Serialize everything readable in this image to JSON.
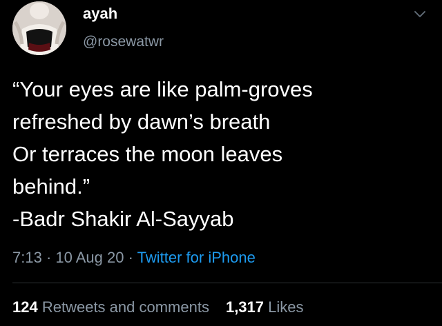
{
  "author": {
    "display_name": "ayah",
    "handle": "@rosewatwr"
  },
  "tweet": {
    "lines": [
      "“Your eyes are like palm-groves",
      "refreshed by dawn’s breath",
      "Or terraces the moon leaves",
      "behind.”",
      "-Badr Shakir Al-Sayyab"
    ],
    "time": "7:13",
    "date": "10 Aug 20",
    "separator": " · ",
    "source": "Twitter for iPhone"
  },
  "stats": {
    "retweets_count": "124",
    "retweets_label": "Retweets and comments",
    "likes_count": "1,317",
    "likes_label": "Likes"
  },
  "icons": {
    "menu": "chevron-down-icon",
    "avatar": "profile-photo"
  },
  "colors": {
    "background": "#000000",
    "text": "#ffffff",
    "secondary": "#8b98a5",
    "link": "#1d9bf0",
    "divider": "#2f3336"
  }
}
